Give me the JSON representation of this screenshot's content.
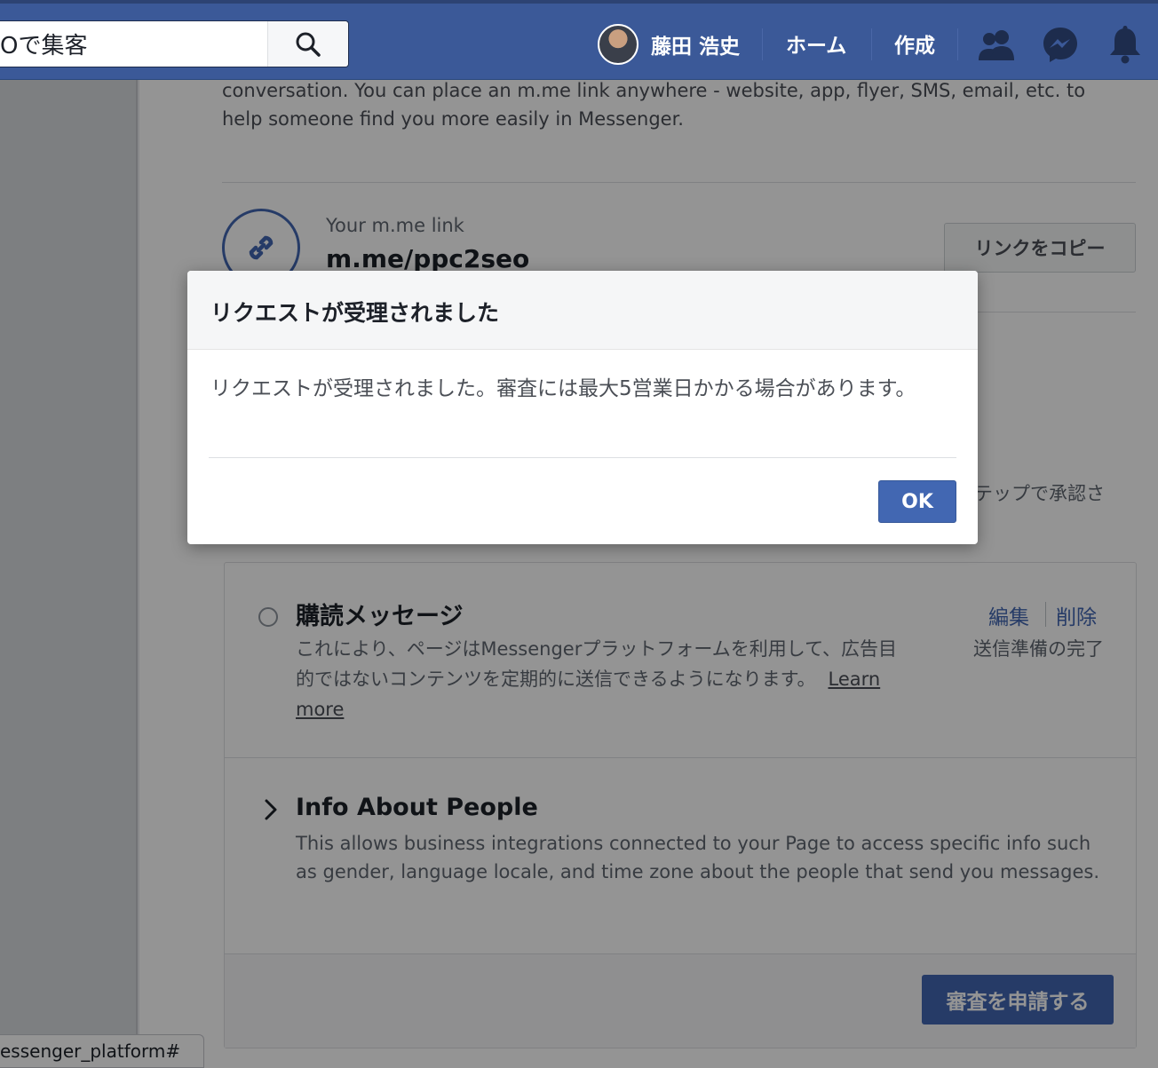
{
  "header": {
    "search_value": "Oで集客",
    "profile_name": "藤田 浩史",
    "nav_home": "ホーム",
    "nav_create": "作成",
    "icons": [
      "search-icon",
      "friends-icon",
      "messenger-icon",
      "notifications-icon"
    ]
  },
  "main": {
    "intro_text": "conversation. You can place an m.me link anywhere - website, app, flyer, SMS, email, etc. to help someone find you more easily in Messenger.",
    "mme_label": "Your m.me link",
    "mme_value": "m.me/ppc2seo",
    "copy_button": "リンクをコピー",
    "obscured_text": "テップで承認さ",
    "subscription": {
      "title": "購読メッセージ",
      "description": "これにより、ページはMessengerプラットフォームを利用して、広告目的ではないコンテンツを定期的に送信できるようになります。",
      "learn_more": "Learn more",
      "edit": "編集",
      "delete": "削除",
      "status": "送信準備の完了"
    },
    "info_about_people": {
      "title": "Info About People",
      "description": "This allows business integrations connected to your Page to access specific info such as gender, language locale, and time zone about the people that send you messages."
    },
    "submit_button": "審査を申請する"
  },
  "status_bar_url": "essenger_platform#",
  "dialog": {
    "title": "リクエストが受理されました",
    "body": "リクエストが受理されました。審査には最大5営業日かかる場合があります。",
    "ok": "OK"
  },
  "colors": {
    "topbar": "#3b5998",
    "accent": "#4267b2"
  }
}
